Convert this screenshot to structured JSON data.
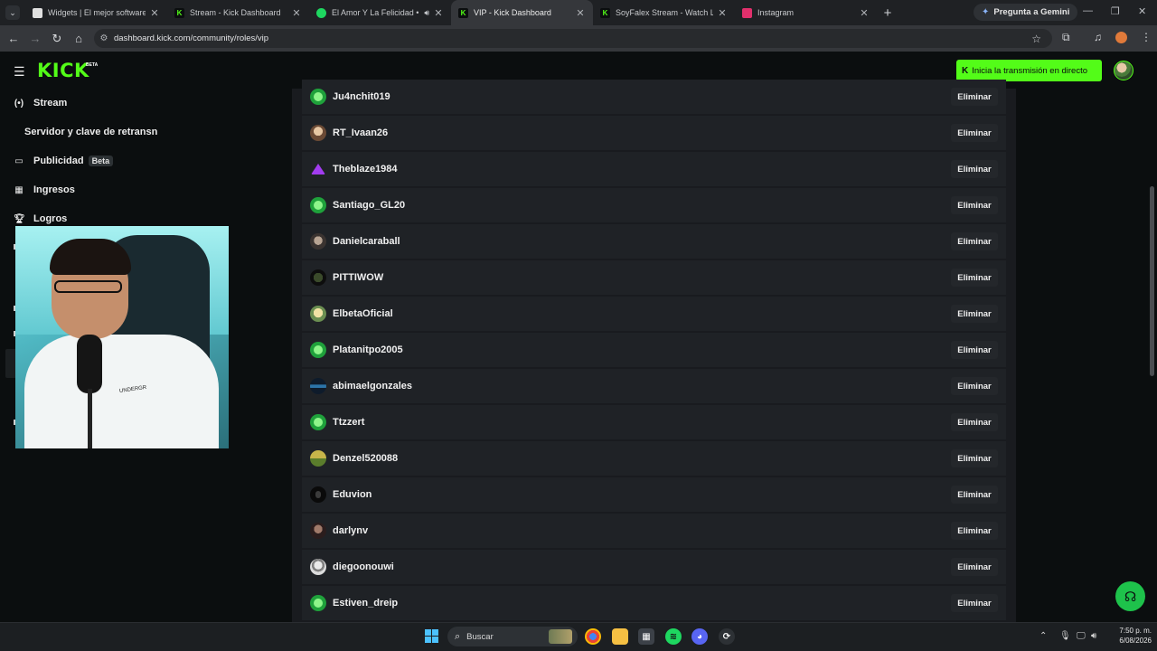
{
  "browser": {
    "tabs": [
      {
        "title": "Widgets | El mejor software para",
        "favicon": "widgets-icon",
        "color": "#e0e0e0",
        "active": false
      },
      {
        "title": "Stream - Kick Dashboard",
        "favicon": "kick-icon",
        "color": "#53fc18",
        "active": false
      },
      {
        "title": "El Amor Y La Felicidad • Ch",
        "favicon": "spotify-icon",
        "color": "#1ed760",
        "active": false,
        "audio": true
      },
      {
        "title": "VIP - Kick Dashboard",
        "favicon": "kick-icon",
        "color": "#53fc18",
        "active": true
      },
      {
        "title": "SoyFalex Stream - Watch Live o",
        "favicon": "kick-icon",
        "color": "#53fc18",
        "active": false
      },
      {
        "title": "Instagram",
        "favicon": "instagram-icon",
        "color": "#e1306c",
        "active": false
      }
    ],
    "gemini_label": "Pregunta a Gemini",
    "url": "dashboard.kick.com/community/roles/vip"
  },
  "header": {
    "logo": "KICK",
    "logo_badge": "BETA",
    "go_live_label": "Inicia la transmisión en directo"
  },
  "sidebar": {
    "items": [
      {
        "label": "Stream",
        "icon": "broadcast-icon"
      },
      {
        "label": "Servidor y clave de retransn",
        "icon": ""
      },
      {
        "label": "Publicidad",
        "icon": "ad-window-icon",
        "badge": "Beta"
      },
      {
        "label": "Ingresos",
        "icon": "chart-icon"
      },
      {
        "label": "Logros",
        "icon": "trophy-icon"
      }
    ]
  },
  "webcam": {
    "shirt_text": "UNDERGR"
  },
  "vip_list": {
    "remove_label": "Eliminar",
    "users": [
      {
        "name": "Ju4nchit019",
        "avatar": "green"
      },
      {
        "name": "RT_Ivaan26",
        "avatar": "photo1"
      },
      {
        "name": "Theblaze1984",
        "avatar": "purple"
      },
      {
        "name": "Santiago_GL20",
        "avatar": "green"
      },
      {
        "name": "Danielcaraball",
        "avatar": "photo2"
      },
      {
        "name": "PITTIWOW",
        "avatar": "dark"
      },
      {
        "name": "ElbetaOficial",
        "avatar": "beta"
      },
      {
        "name": "Platanitpo2005",
        "avatar": "green"
      },
      {
        "name": "abimaelgonzales",
        "avatar": "blue"
      },
      {
        "name": "Ttzzert",
        "avatar": "green"
      },
      {
        "name": "Denzel520088",
        "avatar": "olive"
      },
      {
        "name": "Eduvion",
        "avatar": "black"
      },
      {
        "name": "darlynv",
        "avatar": "photo3"
      },
      {
        "name": "diegoonouwi",
        "avatar": "photo4"
      },
      {
        "name": "Estiven_dreip",
        "avatar": "green"
      }
    ]
  },
  "taskbar": {
    "search_label": "Buscar",
    "time": "7:50 p. m.",
    "date": "6/08/2026"
  },
  "colors": {
    "accent": "#53fc18",
    "background": "#0b0e0f",
    "row": "#1f2226"
  }
}
